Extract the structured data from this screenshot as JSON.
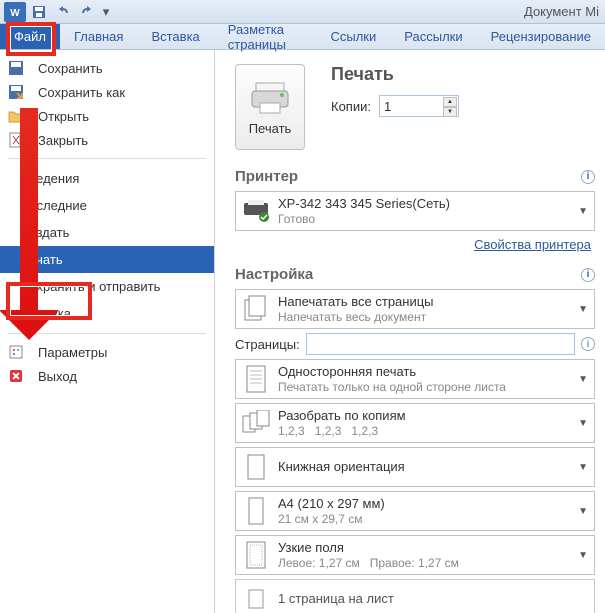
{
  "title": "Документ Mi",
  "ribbon": {
    "tabs": [
      {
        "label": "Файл",
        "active": true
      },
      {
        "label": "Главная"
      },
      {
        "label": "Вставка"
      },
      {
        "label": "Разметка страницы"
      },
      {
        "label": "Ссылки"
      },
      {
        "label": "Рассылки"
      },
      {
        "label": "Рецензирование"
      }
    ]
  },
  "backstage": {
    "items_top": [
      {
        "label": "Сохранить"
      },
      {
        "label": "Сохранить как"
      },
      {
        "label": "Открыть"
      },
      {
        "label": "Закрыть"
      }
    ],
    "cats": [
      {
        "label": "Сведения"
      },
      {
        "label": "Последние"
      },
      {
        "label": "Создать"
      },
      {
        "label": "Печать",
        "selected": true
      },
      {
        "label": "Сохранить и отправить"
      },
      {
        "label": "Справка"
      }
    ],
    "items_bottom": [
      {
        "label": "Параметры"
      },
      {
        "label": "Выход"
      }
    ]
  },
  "print": {
    "header": "Печать",
    "button_label": "Печать",
    "copies_label": "Копии:",
    "copies_value": "1",
    "printer": {
      "heading": "Принтер",
      "name": "XP-342 343 345 Series(Сеть)",
      "status": "Готово",
      "properties_link": "Свойства принтера"
    },
    "settings": {
      "heading": "Настройка",
      "print_all": {
        "title": "Напечатать все страницы",
        "sub": "Напечатать весь документ"
      },
      "pages_label": "Страницы:",
      "one_sided": {
        "title": "Односторонняя печать",
        "sub": "Печатать только на одной стороне листа"
      },
      "collate": {
        "title": "Разобрать по копиям",
        "sub1": "1,2,3",
        "sub2": "1,2,3",
        "sub3": "1,2,3"
      },
      "orientation": {
        "title": "Книжная ориентация"
      },
      "paper": {
        "title": "A4 (210 x 297 мм)",
        "sub": "21 см x 29,7 см"
      },
      "margins": {
        "title": "Узкие поля",
        "sub_left": "Левое: 1,27 см",
        "sub_right": "Правое: 1,27 см"
      },
      "pages_per_sheet_partial": "1 страница на лист"
    }
  }
}
